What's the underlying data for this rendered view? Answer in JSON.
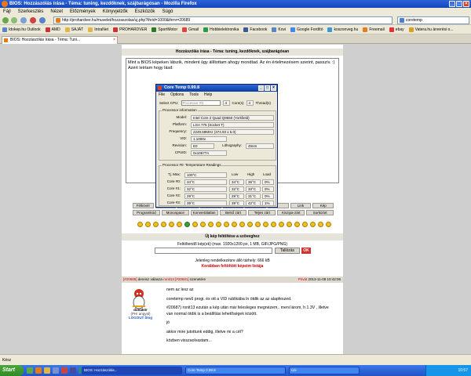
{
  "browser": {
    "title": "BIOS: Hozzászólás írása - Téma: tuning, kezdőknek, szájbarágósan - Mozilla Firefox",
    "menu": [
      "Fájl",
      "Szerkesztés",
      "Nézet",
      "Előzmények",
      "Könyvjelzők",
      "Eszközök",
      "Súgó"
    ],
    "url": "http://prohardver.hu/muvelet/hozzaszolas/uj.php?thrid=1000&thrnr=20689",
    "search_value": "coretemp",
    "bookmarks": [
      "Idokep.hu Outlook",
      "AMD",
      "SAJÁT",
      "IntraNet",
      "PROHARDVER",
      "SportMotor",
      "Gmail",
      "Hobbielektronika",
      "Facebook",
      "Kovi",
      "Google Fordító",
      "koszonveg.hu",
      "Freemail",
      "ebay",
      "Vatera.hu árverési o..."
    ],
    "tab_label": "BIOS: Hozzászólás írása - Téma: Tuni..."
  },
  "page": {
    "header": "Hozzászólás írása - Téma: tuning, kezdőknek, szájbarágósan",
    "editor_text": "Mint a BIOS képeken látszik, mindent úgy állítottam ahogy mondtad. Az én értelmezésem szerint, passzív. :) Azért leírtam hogy lásd:",
    "edit_buttons_row1": [
      "Félkövér",
      "",
      "",
      "",
      "",
      "",
      "",
      "Link",
      "Kép"
    ],
    "edit_buttons_row2": [
      "Programkód",
      "Monospace",
      "Konvertálatlan",
      "Belső zárt",
      "Teljes zárt",
      "Kiszipa-zárt",
      "Sorkizárt"
    ],
    "upload_header": "Új kép feltöltése a szöveghez",
    "upload_info": "Feltöltendő kép(ek) (max. 1920x1200 px, 1 MB, GIF/JPG/PNG)",
    "browse_label": "Tallózás",
    "ok_label": "OK",
    "limit_line1": "Jelenleg rendelkezésre álló tárhely: 666 kB",
    "limit_line2": "Korábban feltöltött képeim listája"
  },
  "coretemp": {
    "title": "Core Temp 0.99.8",
    "menu": [
      "File",
      "Options",
      "Tools",
      "Help"
    ],
    "select_cpu_label": "Select CPU:",
    "select_cpu_value": "Processor #0",
    "cores_value": "4",
    "cores_label": "Core(s)",
    "threads_value": "4",
    "threads_label": "Thread(s)",
    "processor_info_label": "Processor information",
    "model_label": "Model:",
    "model_value": "Intel Core 2 Quad Q9550 (Yorkfield)",
    "platform_label": "Platform:",
    "platform_value": "LGA 775 (Socket T)",
    "frequency_label": "Frequency:",
    "frequency_value": "2249.59MHz (374.93 x 6.0)",
    "vid_label": "VID:",
    "vid_value": "1.1000v",
    "lithography_label": "Lithography:",
    "lithography_value": "45nm",
    "revision_label": "Revision:",
    "revision_value": "E0",
    "cpuid_label": "CPUID:",
    "cpuid_value": "0x10677A",
    "temp_group_label": "Processor #0: Temperature Readings",
    "tjmax_label": "Tj. Max:",
    "tjmax_value": "100°C",
    "col_low": "Low",
    "col_high": "High",
    "col_load": "Load",
    "cores": [
      {
        "label": "Core #0:",
        "temp": "34°C",
        "low": "34°C",
        "high": "36°C",
        "load": "0%"
      },
      {
        "label": "Core #1:",
        "temp": "32°C",
        "low": "32°C",
        "high": "33°C",
        "load": "0%"
      },
      {
        "label": "Core #2:",
        "temp": "29°C",
        "low": "29°C",
        "high": "31°C",
        "load": "0%"
      },
      {
        "label": "Core #3:",
        "temp": "39°C",
        "low": "39°C",
        "high": "42°C",
        "load": "1%"
      }
    ]
  },
  "comment": {
    "header_id": "[#20685]",
    "header_user": "dereisz",
    "header_mid": "válasza",
    "header_ref": "ronit13",
    "header_ref_id": "[#20681]",
    "header_tail": "üzenetére",
    "header_private": "Privát",
    "header_date": "2013-11-08 10:42:06",
    "username": "dunakör",
    "rank": "(PH! angyal)",
    "logout": "LOGOUT blog",
    "paragraphs": [
      "nem az lesz az",
      "coretemp nevű progi. és ott a VID rublikába ln ötdik az az alapfeszed.",
      "#20687) ronit13 ezután a kép után már felesleges megnézem.. meni lárom, h 1.3V , illetve van normal ötdik is a beállítási lehetőségek között.",
      "jó",
      "akkor mire jutottunk eddig, illetve mi a cél?",
      "közben visszaolvastam..."
    ]
  },
  "statusbar": {
    "text": "Kész"
  },
  "taskbar": {
    "start_label": "Start",
    "tasks": [
      "BIOS: Hozzászólás...",
      "Core Temp 0.99.8",
      "Úá-"
    ],
    "clock": "10:57"
  }
}
